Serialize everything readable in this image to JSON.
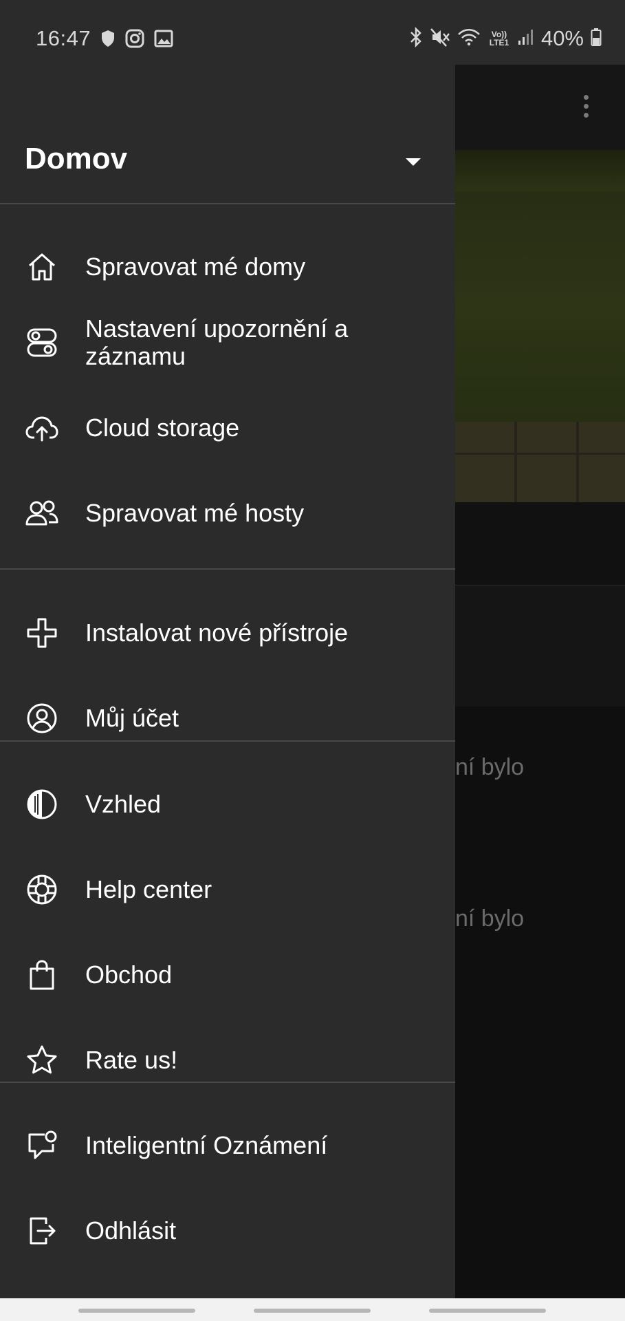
{
  "status_bar": {
    "time": "16:47",
    "lte": "Vo)) LTE1",
    "battery": "40%"
  },
  "drawer": {
    "home_title": "Domov",
    "groups": [
      [
        "Spravovat mé domy",
        "Nastavení upozornění a záznamu",
        "Cloud storage",
        "Spravovat mé hosty"
      ],
      [
        "Instalovat nové přístroje",
        "Můj účet"
      ],
      [
        "Vzhled",
        "Help center",
        "Obchod",
        "Rate us!"
      ],
      [
        "Inteligentní Oznámení",
        "Odhlásit"
      ]
    ],
    "items": [
      {
        "label": "Spravovat mé domy",
        "icon": "home-icon"
      },
      {
        "label": "Nastavení upozornění a záznamu",
        "icon": "notification-settings-icon"
      },
      {
        "label": "Cloud storage",
        "icon": "cloud-upload-icon"
      },
      {
        "label": "Spravovat mé hosty",
        "icon": "guests-icon"
      },
      {
        "label": "Instalovat nové přístroje",
        "icon": "plus-icon"
      },
      {
        "label": "Můj účet",
        "icon": "account-icon"
      },
      {
        "label": "Vzhled",
        "icon": "appearance-icon"
      },
      {
        "label": "Help center",
        "icon": "lifebuoy-icon"
      },
      {
        "label": "Obchod",
        "icon": "shopping-bag-icon"
      },
      {
        "label": "Rate us!",
        "icon": "star-icon"
      },
      {
        "label": "Inteligentní Oznámení",
        "icon": "smart-notification-icon"
      },
      {
        "label": "Odhlásit",
        "icon": "logout-icon"
      }
    ]
  },
  "background": {
    "text_1": "ní bylo",
    "text_2": "ní bylo"
  },
  "colors": {
    "drawer_bg": "#2b2b2b",
    "divider": "#484848",
    "text": "#ffffff",
    "background_app": "#0f0f0f"
  }
}
